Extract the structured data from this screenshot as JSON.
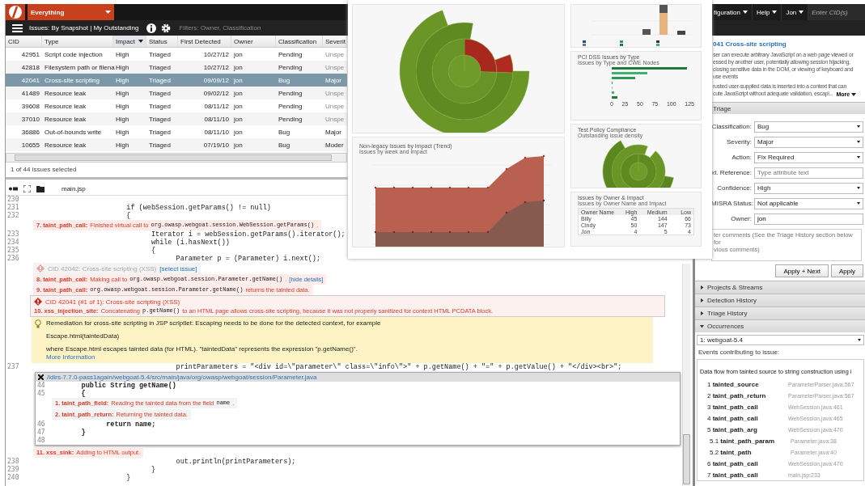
{
  "header": {
    "scope": "Everything",
    "view": "Issues: By Snapshot | My Outstanding",
    "filters": "Filters: Owner, Classification"
  },
  "table": {
    "columns": [
      {
        "label": "CID",
        "sorted": false
      },
      {
        "label": "Type",
        "sorted": false
      },
      {
        "label": "Impact",
        "sorted": true
      },
      {
        "label": "Status",
        "sorted": false
      },
      {
        "label": "First Detected",
        "sorted": false
      },
      {
        "label": "Owner",
        "sorted": false
      },
      {
        "label": "Classification",
        "sorted": false
      },
      {
        "label": "Severit",
        "sorted": false
      }
    ],
    "rows": [
      {
        "cells": [
          "42951",
          "Script code injection",
          "High",
          "Triaged",
          "10/27/12",
          "jon",
          "Pending",
          "Unspe"
        ],
        "selected": false,
        "greyed": true
      },
      {
        "cells": [
          "42818",
          "Filesystem path or filena",
          "High",
          "Triaged",
          "10/27/12",
          "jon",
          "Pending",
          "Unspe"
        ],
        "selected": false,
        "greyed": true
      },
      {
        "cells": [
          "42041",
          "Cross-site scripting",
          "High",
          "Triaged",
          "09/09/12",
          "jon",
          "Bug",
          "Major"
        ],
        "selected": true,
        "greyed": false
      },
      {
        "cells": [
          "41489",
          "Resource leak",
          "High",
          "Triaged",
          "09/02/12",
          "jon",
          "Pending",
          "Unspe"
        ],
        "selected": false,
        "greyed": true
      },
      {
        "cells": [
          "39608",
          "Resource leak",
          "High",
          "Triaged",
          "08/11/12",
          "jon",
          "Pending",
          "Unspe"
        ],
        "selected": false,
        "greyed": true
      },
      {
        "cells": [
          "37010",
          "Resource leak",
          "High",
          "Triaged",
          "08/11/10",
          "jon",
          "Pending",
          "Unspe"
        ],
        "selected": false,
        "greyed": true
      },
      {
        "cells": [
          "36886",
          "Out-of-bounds write",
          "High",
          "Triaged",
          "08/11/10",
          "jon",
          "Bug",
          "Major"
        ],
        "selected": false,
        "greyed": false
      },
      {
        "cells": [
          "10655",
          "Resource leak",
          "High",
          "Triaged",
          "07/19/10",
          "jon",
          "Bug",
          "Moder"
        ],
        "selected": false,
        "greyed": false
      }
    ],
    "status": "1 of 44 issues selected"
  },
  "source": {
    "file": "main.jsp",
    "items": [
      {
        "kind": "line",
        "num": "230"
      },
      {
        "kind": "line",
        "num": "231",
        "code": "                       if (webSession.getParams() != null)"
      },
      {
        "kind": "line",
        "num": "232",
        "code": "                       {"
      },
      {
        "kind": "event",
        "tag": "7. taint_path_call:",
        "parts": [
          {
            "kind": "text",
            "t": "Finished virtual call to"
          },
          {
            "kind": "code",
            "t": "org.owasp.webgoat.session.WebSession.getParams()"
          },
          {
            "kind": "text",
            "t": "."
          }
        ]
      },
      {
        "kind": "line",
        "num": "233",
        "code": "                             Iterator i = webSession.getParams().iterator();"
      },
      {
        "kind": "line",
        "num": "234",
        "code": "                             while (i.hasNext())"
      },
      {
        "kind": "line",
        "num": "235",
        "code": "                             {"
      },
      {
        "kind": "line",
        "num": "236",
        "code": "                                   Parameter p = (Parameter) i.next();"
      },
      {
        "kind": "issue",
        "active": false,
        "title": "CID 42042: Cross-site scripting (XSS)",
        "link": "[select issue]"
      },
      {
        "kind": "event",
        "tag": "8. taint_path_call:",
        "parts": [
          {
            "kind": "text",
            "t": "Making call to"
          },
          {
            "kind": "code",
            "t": "org.owasp.webgoat.session.Parameter.getName()"
          },
          {
            "kind": "text",
            "t": "."
          },
          {
            "kind": "link",
            "t": "[hide details]"
          }
        ]
      },
      {
        "kind": "event",
        "tag": "9. taint_path_call:",
        "parts": [
          {
            "kind": "code",
            "t": "org.owasp.webgoat.session.Parameter.getName()"
          },
          {
            "kind": "text",
            "t": "returns the tainted data."
          }
        ]
      },
      {
        "kind": "issue",
        "active": true,
        "title": "CID 42041 (#1 of 1): Cross-site scripting (XSS)",
        "events": [
          {
            "kind": "event",
            "tag": "10. xss_injection_site:",
            "parts": [
              {
                "kind": "text",
                "t": "Concatenating"
              },
              {
                "kind": "code",
                "t": "p.getName()"
              },
              {
                "kind": "text",
                "t": "to an HTML page allows cross-site scripting, because it was not properly sanitized for context HTML PCDATA block."
              }
            ]
          }
        ]
      },
      {
        "kind": "remedy",
        "lines": [
          "Remediation for cross-site scripting in JSP scriptlet: Escaping needs to be done for the detected context, for example",
          "Escape.html(taintedData)",
          "where Escape.html escapes tainted data (for HTML). \"taintedData\" represents the expression \"p.getName()\"."
        ],
        "link": "More Information"
      },
      {
        "kind": "line",
        "num": "237",
        "code": "                                   printParameters = \"<div id=\\\"parameter\\\" class=\\\"info\\\">\" + p.getName() + \"=\" + p.getValue() + \"</div><br>\";"
      },
      {
        "kind": "popup",
        "path": "/idirs-7.7.0-pass1again/webgoat-5.4/src/main/java/org/owasp/webgoat/session/Parameter.java",
        "items": [
          {
            "kind": "line",
            "num": "44",
            "code": "      public String getName()"
          },
          {
            "kind": "line",
            "num": "45",
            "code": "      {"
          },
          {
            "kind": "event",
            "tag": "1. taint_path_field:",
            "parts": [
              {
                "kind": "text",
                "t": "Reading the tainted data from the field"
              },
              {
                "kind": "code",
                "t": "name"
              },
              {
                "kind": "text",
                "t": "."
              }
            ]
          },
          {
            "kind": "event",
            "tag": "2. taint_path_return:",
            "parts": [
              {
                "kind": "text",
                "t": "Returning the tainted data."
              }
            ]
          },
          {
            "kind": "line",
            "num": "46",
            "code": "            return name;"
          },
          {
            "kind": "line",
            "num": "47",
            "code": "      }"
          },
          {
            "kind": "line",
            "num": "48"
          }
        ]
      },
      {
        "kind": "event",
        "tag": "11. xss_sink:",
        "parts": [
          {
            "kind": "text",
            "t": "Adding to HTML output."
          }
        ]
      },
      {
        "kind": "line",
        "num": "238",
        "code": "                                   out.println(printParameters);"
      },
      {
        "kind": "line",
        "num": "239",
        "code": "                             }"
      },
      {
        "kind": "line",
        "num": "240",
        "code": "                       }"
      }
    ]
  },
  "dashboard": {
    "trend": {
      "title": "Non-legacy Issues by Impact (Trend)",
      "subtitle": "Issues by week and impact"
    },
    "pci": {
      "title": "PCI DSS Issues by Type",
      "subtitle": "Issues by Type and CWE Nodes",
      "ticks": [
        "0",
        "25",
        "50",
        "75",
        "100",
        "125"
      ]
    },
    "policy": {
      "title": "Test Policy Compliance",
      "subtitle": "Outstanding issue density"
    },
    "owners": {
      "title": "Issues by Owner & Impact",
      "subtitle": "Issues by Owner Name and Impact",
      "columns": [
        "Owner Name",
        "High",
        "Medium",
        "Low"
      ],
      "rows": [
        [
          "Billy",
          "45",
          "144",
          "66"
        ],
        [
          "Cindy",
          "50",
          "147",
          "73"
        ],
        [
          "Jon",
          "4",
          "5",
          "4"
        ]
      ]
    }
  },
  "topnav": {
    "items": [
      "figuration",
      "Help",
      "Jon"
    ],
    "cid_placeholder": "Enter CID(s)"
  },
  "issue": {
    "cid": "041",
    "title": "Cross-site scripting",
    "description": [
      "ser can execute arbitrary JavaScript on a web page viewed or",
      "essed by another user, potentially allowing session hijacking,",
      "closing sensitive data in the DOM, or viewing of keyboard and",
      "use events"
    ],
    "detail": [
      "rusted user-supplied data is inserted into a context that can",
      "cute JavaScript without adequate validation, escapi..."
    ],
    "more": "More"
  },
  "triage": {
    "title": "Triage",
    "fields": [
      {
        "label": "Classification:",
        "kind": "select",
        "value": "Bug"
      },
      {
        "label": "Severity:",
        "kind": "select",
        "value": "Major"
      },
      {
        "label": "Action:",
        "kind": "select",
        "value": "Fix Required"
      },
      {
        "label": "xt. Reference:",
        "kind": "input",
        "placeholder": "Type attribute text"
      },
      {
        "label": "Confidence:",
        "kind": "select",
        "value": "High"
      },
      {
        "label": "MISRA Status:",
        "kind": "select",
        "value": "Not applicable"
      },
      {
        "label": "Owner:",
        "kind": "input",
        "value": "jon"
      }
    ],
    "comments_placeholder": "ter comments (See the Triage History section below for\nvious comments)",
    "buttons": [
      "Apply + Next",
      "Apply"
    ]
  },
  "sections": [
    {
      "label": "Projects & Streams",
      "expanded": false
    },
    {
      "label": "Detection History",
      "expanded": false
    },
    {
      "label": "Triage History",
      "expanded": false
    },
    {
      "label": "Occurrences",
      "expanded": true
    }
  ],
  "occurrences": {
    "select": "1: webgoat-5.4",
    "heading": "Events contributing to issue:",
    "flow": "Data flow from tainted source to string construction using i",
    "events": [
      {
        "num": "1",
        "name": "tainted_source",
        "file": "ParameterParser.java:567"
      },
      {
        "num": "2",
        "name": "taint_path_return",
        "file": "ParameterParser.java:567"
      },
      {
        "num": "3",
        "name": "taint_path_call",
        "file": "WebSession.java:461"
      },
      {
        "num": "4",
        "name": "taint_path_call",
        "file": "WebSession.java:465"
      },
      {
        "num": "5",
        "name": "taint_path_arg",
        "file": "WebSession.java:470",
        "children": [
          {
            "num": "5.1",
            "name": "taint_path_param",
            "file": "Parameter.java:38"
          },
          {
            "num": "5.2",
            "name": "taint_path",
            "file": "Parameter.java:40"
          }
        ]
      },
      {
        "num": "6",
        "name": "taint_path_call",
        "file": "WebSession.java:470"
      },
      {
        "num": "7",
        "name": "taint_path_call",
        "file": "main.jsp:233"
      }
    ]
  }
}
